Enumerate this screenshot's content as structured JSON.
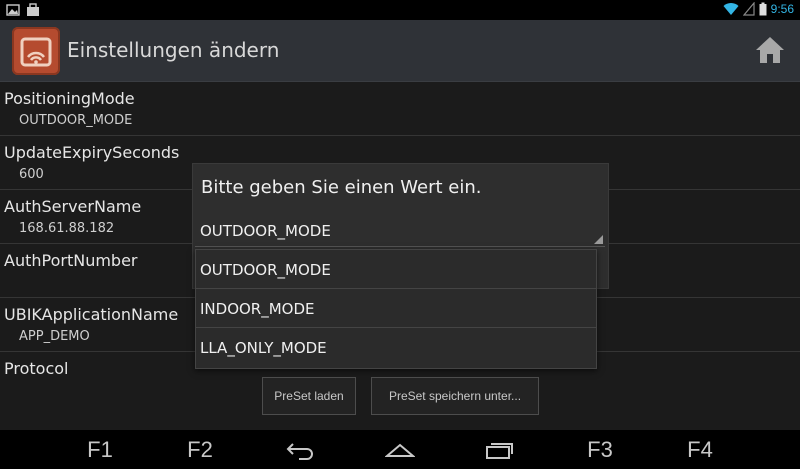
{
  "status": {
    "time": "9:56",
    "accent": "#33b5e5"
  },
  "app": {
    "title": "Einstellungen ändern",
    "icon": "wifi-app-icon"
  },
  "prefs": [
    {
      "title": "PositioningMode",
      "value": "OUTDOOR_MODE"
    },
    {
      "title": "UpdateExpirySeconds",
      "value": "600"
    },
    {
      "title": "AuthServerName",
      "value": "168.61.88.182"
    },
    {
      "title": "AuthPortNumber",
      "value": ""
    },
    {
      "title": "UBIKApplicationName",
      "value": "APP_DEMO"
    },
    {
      "title": "Protocol",
      "value": ""
    }
  ],
  "buttons": {
    "preset_load": "PreSet laden",
    "preset_save": "PreSet speichern unter..."
  },
  "dialog": {
    "title": "Bitte geben Sie einen Wert ein.",
    "selected": "OUTDOOR_MODE",
    "options": [
      "OUTDOOR_MODE",
      "INDOOR_MODE",
      "LLA_ONLY_MODE"
    ]
  },
  "nav": {
    "f1": "F1",
    "f2": "F2",
    "f3": "F3",
    "f4": "F4"
  }
}
